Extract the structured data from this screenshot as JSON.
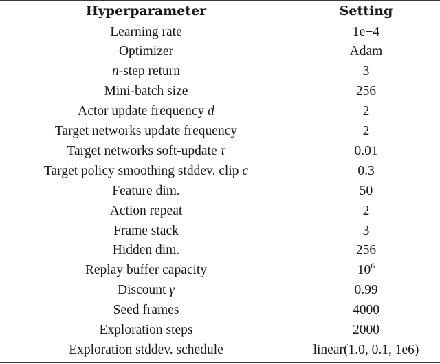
{
  "table": {
    "headers": {
      "param": "Hyperparameter",
      "setting": "Setting"
    },
    "rows": [
      {
        "param_prefix": "",
        "param_math": "",
        "param_text": "Learning rate",
        "param_suffix_math": "",
        "setting": "1e−4",
        "setting_sup": ""
      },
      {
        "param_prefix": "",
        "param_math": "",
        "param_text": "Optimizer",
        "param_suffix_math": "",
        "setting": "Adam",
        "setting_sup": ""
      },
      {
        "param_prefix": "",
        "param_math": "n",
        "param_text": "-step return",
        "param_suffix_math": "",
        "setting": "3",
        "setting_sup": ""
      },
      {
        "param_prefix": "",
        "param_math": "",
        "param_text": "Mini-batch size",
        "param_suffix_math": "",
        "setting": "256",
        "setting_sup": ""
      },
      {
        "param_prefix": "",
        "param_math": "",
        "param_text": "Actor update frequency ",
        "param_suffix_math": "d",
        "setting": "2",
        "setting_sup": ""
      },
      {
        "param_prefix": "",
        "param_math": "",
        "param_text": "Target networks update frequency",
        "param_suffix_math": "",
        "setting": "2",
        "setting_sup": ""
      },
      {
        "param_prefix": "",
        "param_math": "",
        "param_text": "Target networks soft-update ",
        "param_suffix_math": "τ",
        "setting": "0.01",
        "setting_sup": ""
      },
      {
        "param_prefix": "",
        "param_math": "",
        "param_text": "Target policy smoothing stddev. clip ",
        "param_suffix_math": "c",
        "setting": "0.3",
        "setting_sup": ""
      },
      {
        "param_prefix": "",
        "param_math": "",
        "param_text": "Feature dim.",
        "param_suffix_math": "",
        "setting": "50",
        "setting_sup": ""
      },
      {
        "param_prefix": "",
        "param_math": "",
        "param_text": "Action repeat",
        "param_suffix_math": "",
        "setting": "2",
        "setting_sup": ""
      },
      {
        "param_prefix": "",
        "param_math": "",
        "param_text": "Frame stack",
        "param_suffix_math": "",
        "setting": "3",
        "setting_sup": ""
      },
      {
        "param_prefix": "",
        "param_math": "",
        "param_text": "Hidden dim.",
        "param_suffix_math": "",
        "setting": "256",
        "setting_sup": ""
      },
      {
        "param_prefix": "",
        "param_math": "",
        "param_text": "Replay buffer capacity",
        "param_suffix_math": "",
        "setting": "10",
        "setting_sup": "6"
      },
      {
        "param_prefix": "",
        "param_math": "",
        "param_text": "Discount ",
        "param_suffix_math": "γ",
        "setting": "0.99",
        "setting_sup": ""
      },
      {
        "param_prefix": "",
        "param_math": "",
        "param_text": "Seed frames",
        "param_suffix_math": "",
        "setting": "4000",
        "setting_sup": ""
      },
      {
        "param_prefix": "",
        "param_math": "",
        "param_text": "Exploration steps",
        "param_suffix_math": "",
        "setting": "2000",
        "setting_sup": ""
      },
      {
        "param_prefix": "",
        "param_math": "",
        "param_text": "Exploration stddev. schedule",
        "param_suffix_math": "",
        "setting": "linear(1.0, 0.1, 1e6)",
        "setting_sup": ""
      }
    ]
  }
}
